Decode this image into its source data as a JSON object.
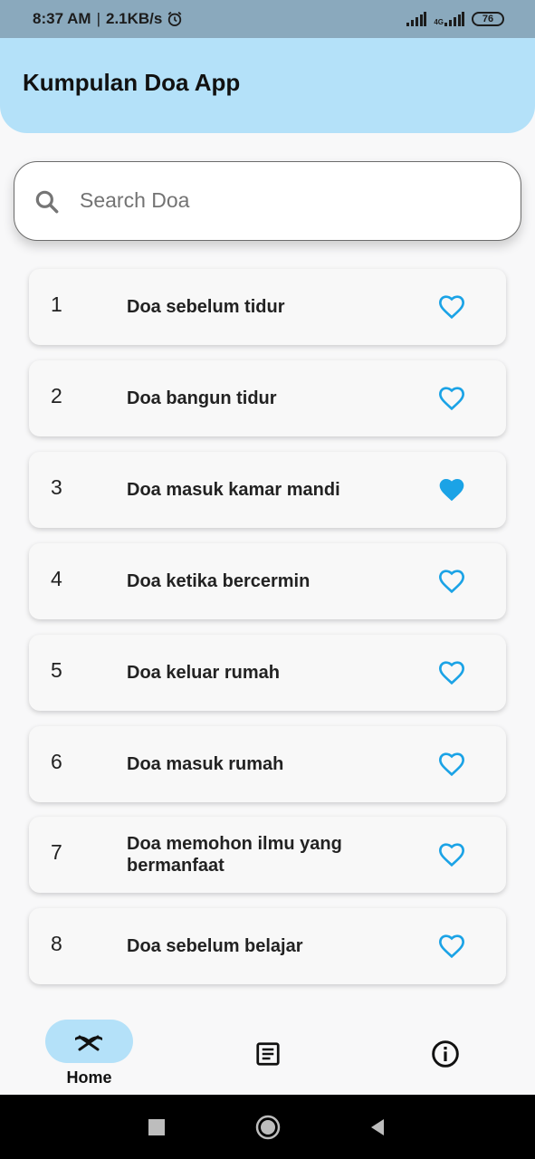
{
  "status_bar": {
    "time": "8:37 AM",
    "separator": "|",
    "speed": "2.1KB/s",
    "network": "4G",
    "battery": "76"
  },
  "app_bar": {
    "title": "Kumpulan Doa App"
  },
  "search": {
    "placeholder": "Search Doa",
    "value": ""
  },
  "doa_list": [
    {
      "number": "1",
      "title": "Doa sebelum tidur",
      "favorite": false
    },
    {
      "number": "2",
      "title": "Doa bangun tidur",
      "favorite": false
    },
    {
      "number": "3",
      "title": "Doa masuk kamar mandi",
      "favorite": true
    },
    {
      "number": "4",
      "title": "Doa ketika bercermin",
      "favorite": false
    },
    {
      "number": "5",
      "title": "Doa keluar rumah",
      "favorite": false
    },
    {
      "number": "6",
      "title": "Doa masuk rumah",
      "favorite": false
    },
    {
      "number": "7",
      "title": "Doa memohon ilmu yang bermanfaat",
      "favorite": false
    },
    {
      "number": "8",
      "title": "Doa sebelum belajar",
      "favorite": false
    }
  ],
  "bottom_nav": {
    "home_label": "Home",
    "icons": [
      "quran-icon",
      "list-icon",
      "info-icon"
    ]
  },
  "colors": {
    "accent": "#1ba3e6",
    "app_bar": "#b4e1f9",
    "status_bar": "#8aa9bd"
  }
}
